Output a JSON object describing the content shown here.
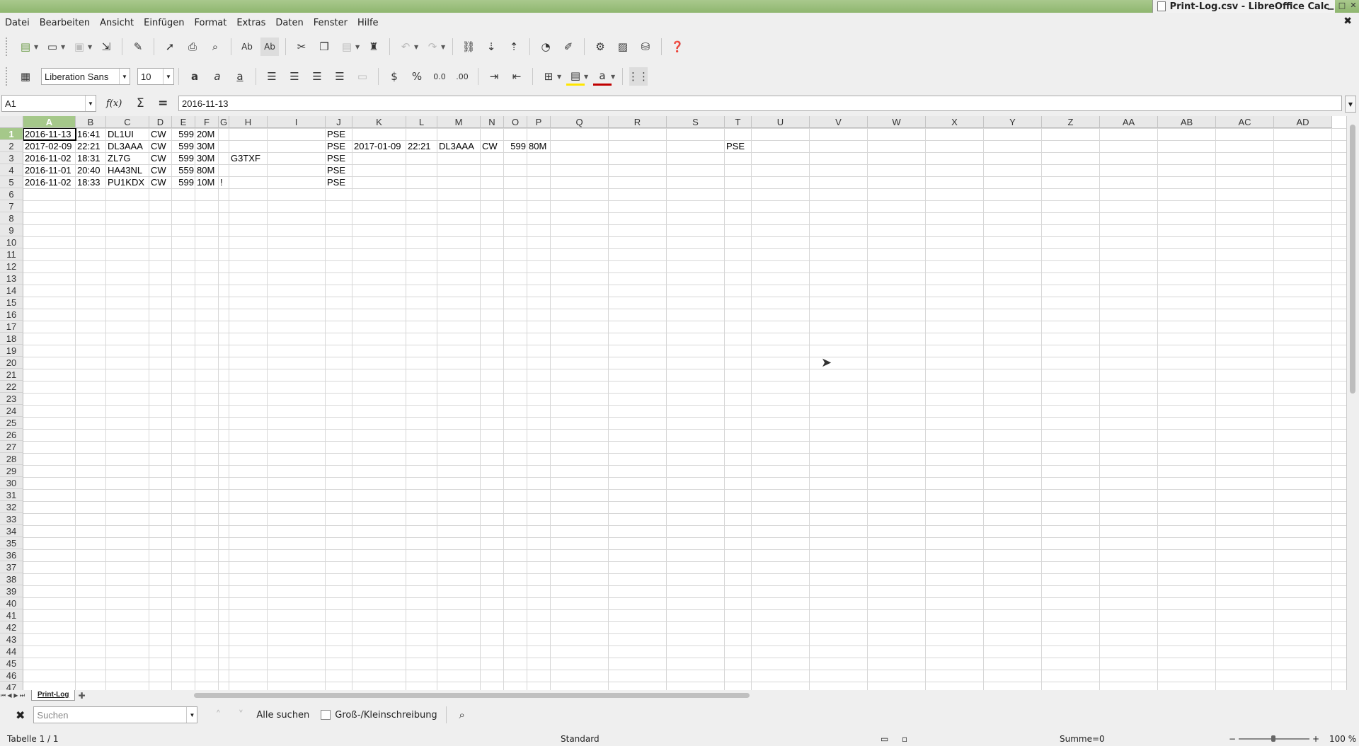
{
  "window": {
    "title": "Print-Log.csv - LibreOffice Calc"
  },
  "menu": [
    "Datei",
    "Bearbeiten",
    "Ansicht",
    "Einfügen",
    "Format",
    "Extras",
    "Daten",
    "Fenster",
    "Hilfe"
  ],
  "font": {
    "name": "Liberation Sans",
    "size": "10"
  },
  "formula": {
    "cell_ref": "A1",
    "fx": "f(x)",
    "content": "2016-11-13"
  },
  "columns": [
    "A",
    "B",
    "C",
    "D",
    "E",
    "F",
    "G",
    "H",
    "I",
    "J",
    "K",
    "L",
    "M",
    "N",
    "O",
    "P",
    "Q",
    "R",
    "S",
    "T",
    "U",
    "V",
    "W",
    "X",
    "Y",
    "Z",
    "AA",
    "AB",
    "AC",
    "AD"
  ],
  "selected_column": "A",
  "selected_row": "1",
  "cells": [
    {
      "col": "A",
      "row": 1,
      "v": "2016-11-13",
      "num": false
    },
    {
      "col": "B",
      "row": 1,
      "v": "16:41",
      "num": false
    },
    {
      "col": "C",
      "row": 1,
      "v": "DL1UI",
      "num": false
    },
    {
      "col": "D",
      "row": 1,
      "v": "CW",
      "num": false
    },
    {
      "col": "E",
      "row": 1,
      "v": "599",
      "num": true
    },
    {
      "col": "F",
      "row": 1,
      "v": "20M",
      "num": false
    },
    {
      "col": "J",
      "row": 1,
      "v": "PSE",
      "num": false
    },
    {
      "col": "A",
      "row": 2,
      "v": "2017-02-09",
      "num": false
    },
    {
      "col": "B",
      "row": 2,
      "v": "22:21",
      "num": false
    },
    {
      "col": "C",
      "row": 2,
      "v": "DL3AAA",
      "num": false
    },
    {
      "col": "D",
      "row": 2,
      "v": "CW",
      "num": false
    },
    {
      "col": "E",
      "row": 2,
      "v": "599",
      "num": true
    },
    {
      "col": "F",
      "row": 2,
      "v": "30M",
      "num": false
    },
    {
      "col": "J",
      "row": 2,
      "v": "PSE",
      "num": false
    },
    {
      "col": "K",
      "row": 2,
      "v": "2017-01-09",
      "num": false
    },
    {
      "col": "L",
      "row": 2,
      "v": "22:21",
      "num": false
    },
    {
      "col": "M",
      "row": 2,
      "v": "DL3AAA",
      "num": false
    },
    {
      "col": "N",
      "row": 2,
      "v": "CW",
      "num": false
    },
    {
      "col": "O",
      "row": 2,
      "v": "599",
      "num": true
    },
    {
      "col": "P",
      "row": 2,
      "v": "80M",
      "num": false
    },
    {
      "col": "T",
      "row": 2,
      "v": "PSE",
      "num": false
    },
    {
      "col": "A",
      "row": 3,
      "v": "2016-11-02",
      "num": false
    },
    {
      "col": "B",
      "row": 3,
      "v": "18:31",
      "num": false
    },
    {
      "col": "C",
      "row": 3,
      "v": "ZL7G",
      "num": false
    },
    {
      "col": "D",
      "row": 3,
      "v": "CW",
      "num": false
    },
    {
      "col": "E",
      "row": 3,
      "v": "599",
      "num": true
    },
    {
      "col": "F",
      "row": 3,
      "v": "30M",
      "num": false
    },
    {
      "col": "H",
      "row": 3,
      "v": "G3TXF",
      "num": false
    },
    {
      "col": "J",
      "row": 3,
      "v": "PSE",
      "num": false
    },
    {
      "col": "A",
      "row": 4,
      "v": "2016-11-01",
      "num": false
    },
    {
      "col": "B",
      "row": 4,
      "v": "20:40",
      "num": false
    },
    {
      "col": "C",
      "row": 4,
      "v": "HA43NL",
      "num": false
    },
    {
      "col": "D",
      "row": 4,
      "v": "CW",
      "num": false
    },
    {
      "col": "E",
      "row": 4,
      "v": "559",
      "num": true
    },
    {
      "col": "F",
      "row": 4,
      "v": "80M",
      "num": false
    },
    {
      "col": "J",
      "row": 4,
      "v": "PSE",
      "num": false
    },
    {
      "col": "A",
      "row": 5,
      "v": "2016-11-02",
      "num": false
    },
    {
      "col": "B",
      "row": 5,
      "v": "18:33",
      "num": false
    },
    {
      "col": "C",
      "row": 5,
      "v": "PU1KDX",
      "num": false
    },
    {
      "col": "D",
      "row": 5,
      "v": "CW",
      "num": false
    },
    {
      "col": "E",
      "row": 5,
      "v": "599",
      "num": true
    },
    {
      "col": "F",
      "row": 5,
      "v": "10M",
      "num": false
    },
    {
      "col": "G",
      "row": 5,
      "v": "!",
      "num": false
    },
    {
      "col": "J",
      "row": 5,
      "v": "PSE",
      "num": false
    }
  ],
  "sheet": {
    "tab_name": "Print-Log"
  },
  "find": {
    "placeholder": "Suchen",
    "find_all": "Alle suchen",
    "match_case": "Groß-/Kleinschreibung"
  },
  "status": {
    "sheet_info": "Tabelle 1 / 1",
    "page_style": "Standard",
    "sum": "Summe=0",
    "zoom": "100 %"
  },
  "colors": {
    "accent": "#a5c88a",
    "title_bar": "#8fb66f"
  }
}
